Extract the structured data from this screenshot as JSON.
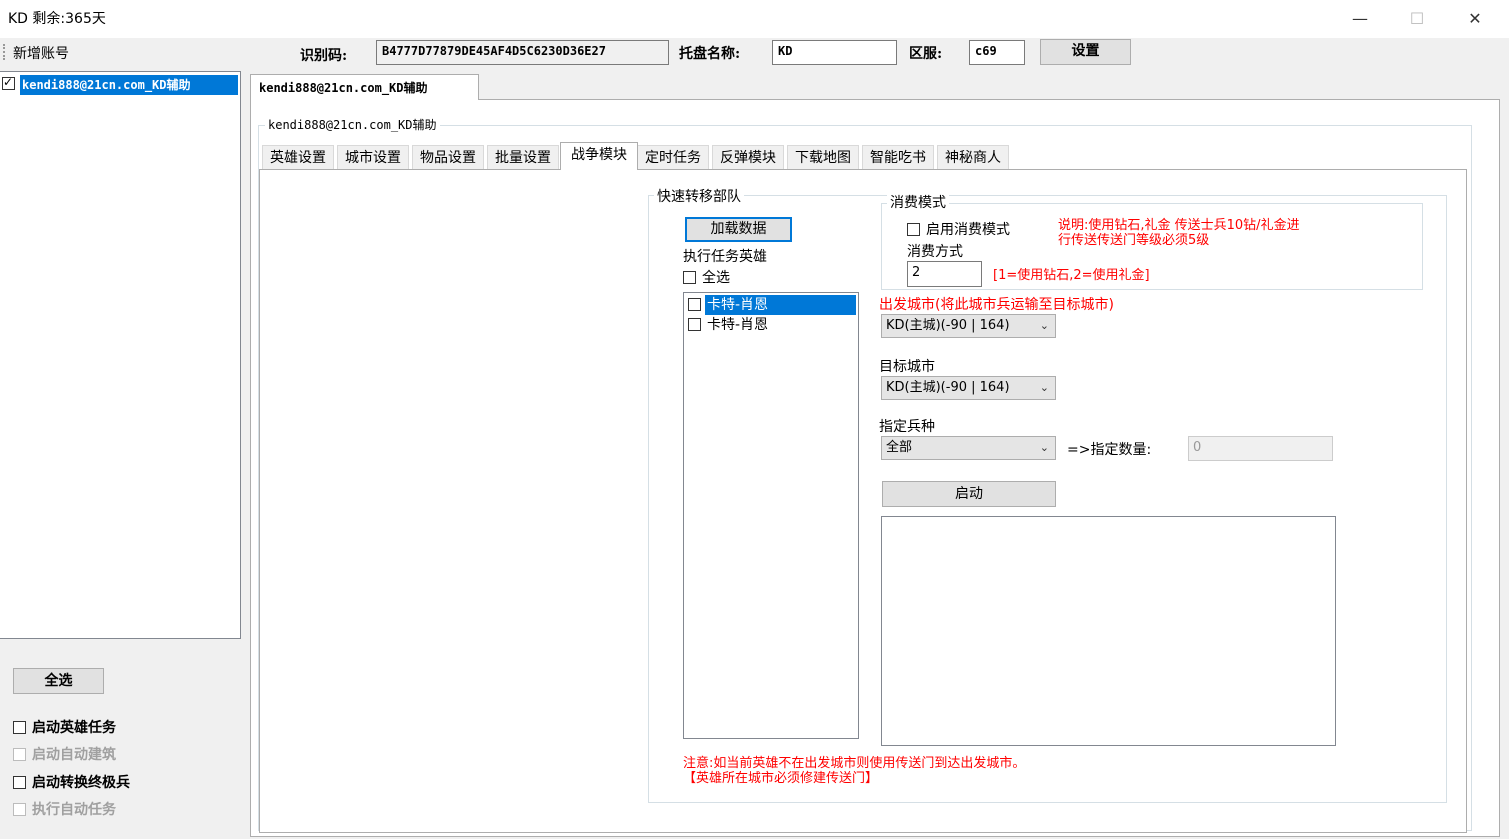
{
  "window": {
    "title": "KD 剩余:365天",
    "min": "—",
    "max": "☐",
    "close": "✕"
  },
  "toolbar": {
    "add_account": "新增账号",
    "id_label": "识别码:",
    "id_value": "B4777D77879DE45AF4D5C6230D36E27",
    "host_label": "托盘名称:",
    "host_value": "KD",
    "server_label": "区服:",
    "server_value": "c69",
    "settings_button": "设置"
  },
  "accounts": {
    "items": [
      {
        "label": "kendi888@21cn.com_KD辅助",
        "checked": true
      }
    ],
    "select_all": "全选",
    "options": [
      {
        "label": "启动英雄任务",
        "enabled": true,
        "checked": false
      },
      {
        "label": "启动自动建筑",
        "enabled": false,
        "checked": false
      },
      {
        "label": "启动转换终极兵",
        "enabled": true,
        "checked": false
      },
      {
        "label": "执行自动任务",
        "enabled": false,
        "checked": false
      }
    ]
  },
  "account_tab": "kendi888@21cn.com_KD辅助",
  "group_title": "kendi888@21cn.com_KD辅助",
  "tabs": [
    {
      "label": "英雄设置"
    },
    {
      "label": "城市设置"
    },
    {
      "label": "物品设置"
    },
    {
      "label": "批量设置"
    },
    {
      "label": "战争模块",
      "active": true
    },
    {
      "label": "定时任务"
    },
    {
      "label": "反弹模块"
    },
    {
      "label": "下载地图"
    },
    {
      "label": "智能吃书"
    },
    {
      "label": "神秘商人"
    }
  ],
  "transfer": {
    "title": "快速转移部队",
    "load_button": "加载数据",
    "heroes_label": "执行任务英雄",
    "select_all": "全选",
    "heroes": [
      {
        "name": "卡特-肖恩",
        "selected": true
      },
      {
        "name": "卡特-肖恩",
        "selected": false
      }
    ],
    "consume": {
      "title": "消费模式",
      "enable_label": "启用消费模式",
      "note_line1": "说明:使用钻石,礼金 传送士兵10钻/礼金进",
      "note_line2": "行传送传送门等级必须5级",
      "method_label": "消费方式",
      "method_value": "2",
      "method_hint": "[1=使用钻石,2=使用礼金]"
    },
    "from_label": "出发城市(将此城市兵运输至目标城市)",
    "from_value": "KD(主城)(-90 | 164)",
    "to_label": "目标城市",
    "to_value": "KD(主城)(-90 | 164)",
    "troop_label": "指定兵种",
    "troop_value": "全部",
    "count_label": "=>指定数量:",
    "count_value": "0",
    "start_button": "启动",
    "warning_line1": "注意:如当前英雄不在出发城市则使用传送门到达出发城市。",
    "warning_line2": "【英雄所在城市必须修建传送门】"
  }
}
